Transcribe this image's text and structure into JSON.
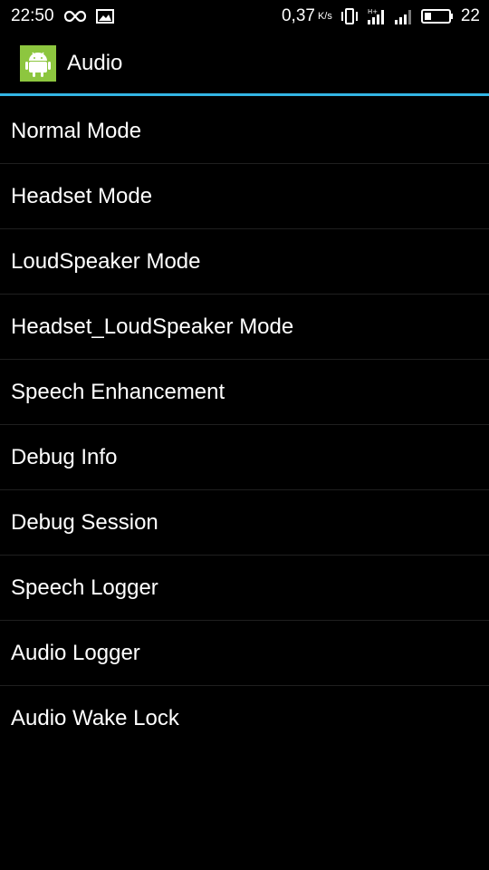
{
  "status_bar": {
    "time": "22:50",
    "net_speed": "0,37",
    "net_speed_unit": "K/s",
    "battery": "22",
    "icons": [
      "infinity-icon",
      "image-icon",
      "vibrate-icon",
      "hplus-signal-icon",
      "signal-icon",
      "battery-icon"
    ]
  },
  "action_bar": {
    "title": "Audio",
    "icon": "android-icon",
    "accent_color": "#33b5e5",
    "icon_color": "#8dc63f"
  },
  "menu": {
    "items": [
      {
        "label": "Normal Mode"
      },
      {
        "label": "Headset Mode"
      },
      {
        "label": "LoudSpeaker Mode"
      },
      {
        "label": "Headset_LoudSpeaker Mode"
      },
      {
        "label": "Speech Enhancement"
      },
      {
        "label": "Debug Info"
      },
      {
        "label": "Debug Session"
      },
      {
        "label": "Speech Logger"
      },
      {
        "label": "Audio Logger"
      },
      {
        "label": "Audio Wake Lock"
      }
    ]
  }
}
